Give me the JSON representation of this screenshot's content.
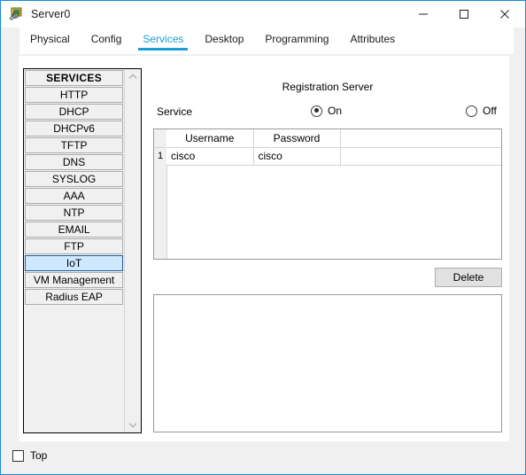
{
  "window": {
    "title": "Server0",
    "icon": "server-device-icon",
    "controls": {
      "minimize": "minimize-icon",
      "maximize": "maximize-icon",
      "close": "close-icon"
    }
  },
  "tabs": [
    {
      "label": "Physical",
      "active": false
    },
    {
      "label": "Config",
      "active": false
    },
    {
      "label": "Services",
      "active": true
    },
    {
      "label": "Desktop",
      "active": false
    },
    {
      "label": "Programming",
      "active": false
    },
    {
      "label": "Attributes",
      "active": false
    }
  ],
  "sidebar": {
    "header": "SERVICES",
    "items": [
      {
        "label": "HTTP"
      },
      {
        "label": "DHCP"
      },
      {
        "label": "DHCPv6"
      },
      {
        "label": "TFTP"
      },
      {
        "label": "DNS"
      },
      {
        "label": "SYSLOG"
      },
      {
        "label": "AAA"
      },
      {
        "label": "NTP"
      },
      {
        "label": "EMAIL"
      },
      {
        "label": "FTP"
      },
      {
        "label": "IoT"
      },
      {
        "label": "VM Management"
      },
      {
        "label": "Radius EAP"
      }
    ],
    "selected": "IoT",
    "scrollbar": {
      "up": "chevron-up-icon",
      "down": "chevron-down-icon"
    }
  },
  "main": {
    "panel_title": "Registration Server",
    "service": {
      "label": "Service",
      "on_label": "On",
      "off_label": "Off",
      "selected": "On"
    },
    "users_table": {
      "columns": [
        "Username",
        "Password"
      ],
      "rows": [
        {
          "index": "1",
          "username": "cisco",
          "password": "cisco"
        }
      ]
    },
    "delete_label": "Delete",
    "log_text": ""
  },
  "footer": {
    "top_label": "Top",
    "top_checked": false
  },
  "colors": {
    "accent": "#1b9fd8",
    "window_border": "#1b8ad4",
    "selection": "#cde8ff",
    "selection_border": "#1f5e9e",
    "panel": "#f0f0f0"
  }
}
